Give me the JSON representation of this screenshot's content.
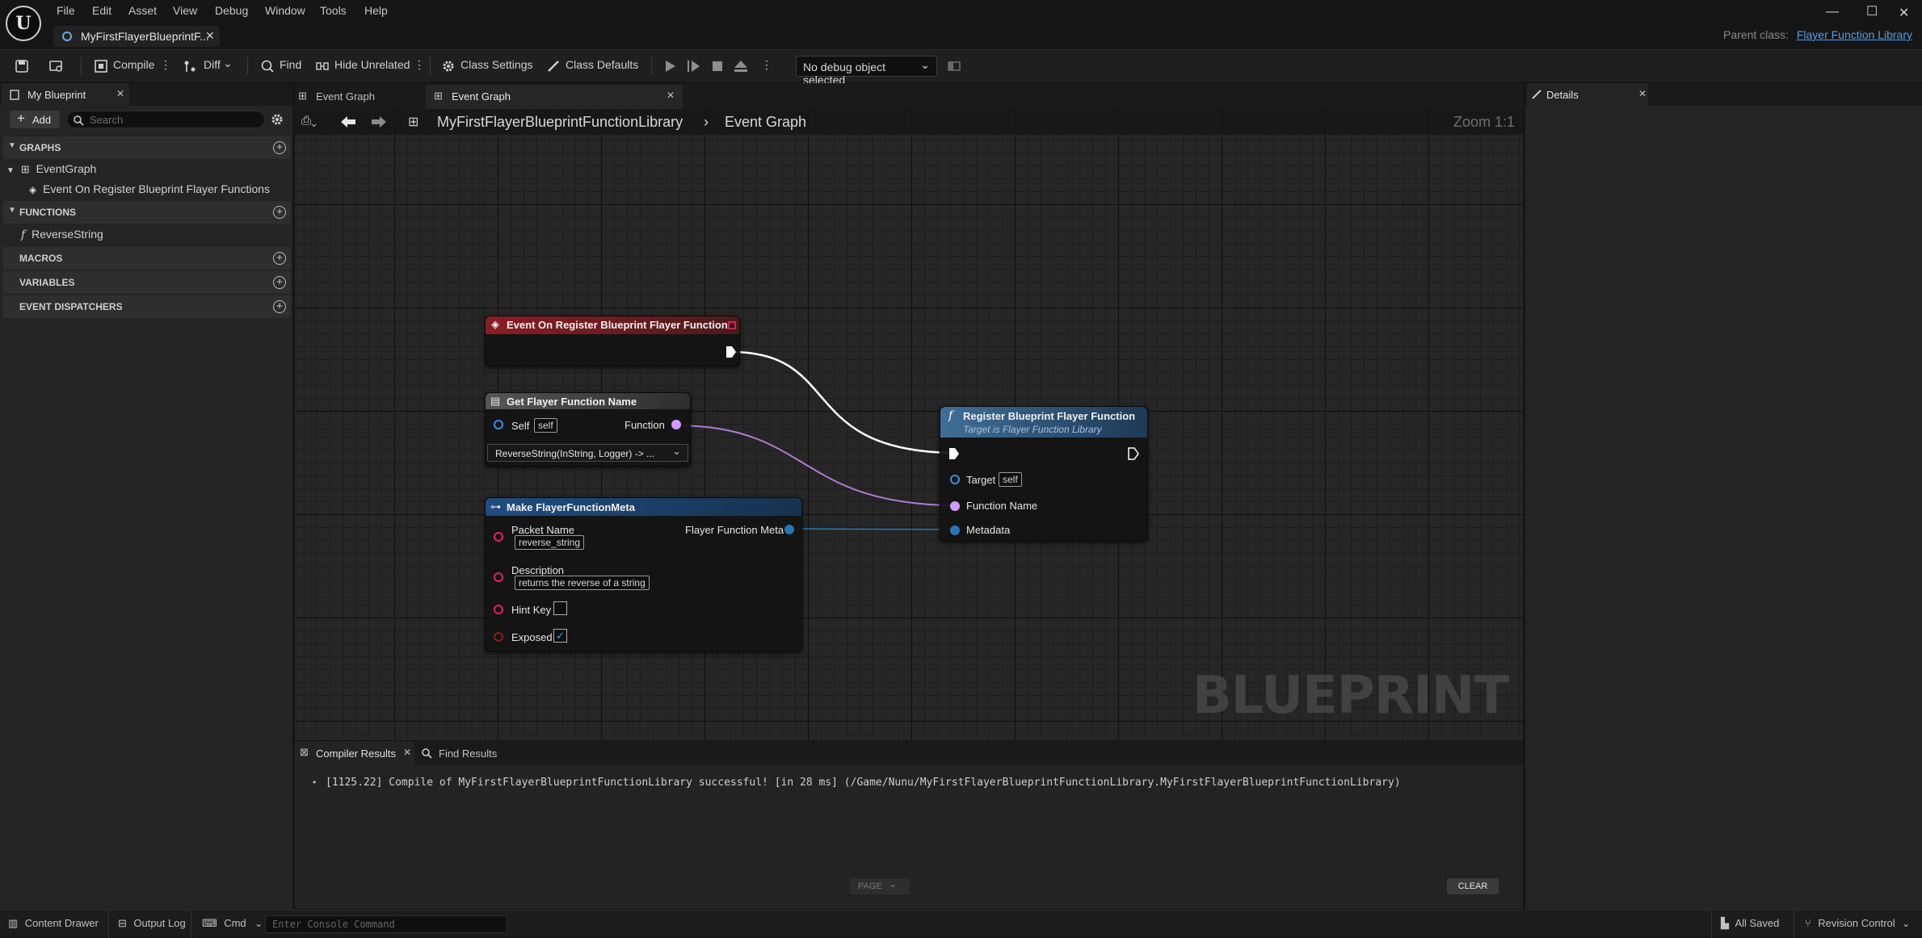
{
  "app": {
    "doc_tab": "MyFirstFlayerBlueprintF...",
    "parent_label": "Parent class:",
    "parent_value": "Flayer Function Library"
  },
  "menu": [
    "File",
    "Edit",
    "Asset",
    "View",
    "Debug",
    "Window",
    "Tools",
    "Help"
  ],
  "toolbar": {
    "compile": "Compile",
    "diff": "Diff",
    "find": "Find",
    "hide_unrelated": "Hide Unrelated",
    "class_settings": "Class Settings",
    "class_defaults": "Class Defaults",
    "debug_object": "No debug object selected"
  },
  "my_blueprint": {
    "tab": "My Blueprint",
    "add": "Add",
    "search_placeholder": "Search",
    "sections": {
      "graphs": "GRAPHS",
      "functions": "FUNCTIONS",
      "macros": "MACROS",
      "variables": "VARIABLES",
      "dispatchers": "EVENT DISPATCHERS"
    },
    "graph_items": [
      "EventGraph",
      "Event On Register Blueprint Flayer Functions"
    ],
    "function_items": [
      "ReverseString"
    ]
  },
  "graph": {
    "tabs": [
      "Event Graph",
      "Event Graph"
    ],
    "breadcrumb": [
      "MyFirstFlayerBlueprintFunctionLibrary",
      "Event Graph"
    ],
    "zoom": "Zoom 1:1",
    "watermark": "BLUEPRINT"
  },
  "nodes": {
    "event": {
      "title": "Event On Register Blueprint Flayer Functions"
    },
    "getname": {
      "title": "Get Flayer Function Name",
      "self_label": "Self",
      "self_value": "self",
      "function_label": "Function",
      "dropdown": "ReverseString(InString, Logger) -> ..."
    },
    "makemeta": {
      "title": "Make FlayerFunctionMeta",
      "packet_label": "Packet Name",
      "packet_value": "reverse_string",
      "description_label": "Description",
      "description_value": "returns the reverse of a string",
      "hint_label": "Hint Key",
      "exposed_label": "Exposed",
      "output_label": "Flayer Function Meta",
      "exposed_checked": true
    },
    "register": {
      "title": "Register Blueprint Flayer Function",
      "subtitle": "Target is Flayer Function Library",
      "target_label": "Target",
      "target_value": "self",
      "fname_label": "Function Name",
      "metadata_label": "Metadata"
    }
  },
  "details": {
    "tab": "Details"
  },
  "bottom": {
    "tabs": [
      "Compiler Results",
      "Find Results"
    ],
    "message": "[1125.22] Compile of MyFirstFlayerBlueprintFunctionLibrary successful! [in 28 ms] (/Game/Nunu/MyFirstFlayerBlueprintFunctionLibrary.MyFirstFlayerBlueprintFunctionLibrary)",
    "page": "PAGE",
    "clear": "CLEAR"
  },
  "status": {
    "content_drawer": "Content Drawer",
    "output_log": "Output Log",
    "cmd": "Cmd",
    "console_placeholder": "Enter Console Command",
    "saved": "All Saved",
    "revision": "Revision Control"
  },
  "colors": {
    "event_header": "#8a1d24",
    "func_header": "#2f4e6a",
    "struct_header": "#1e4d80",
    "exec_wire": "#ffffff",
    "string_wire": "#b07ad2",
    "struct_wire": "#2a74b8",
    "object_pin": "#3d8ee6",
    "string_pin": "#d39bff",
    "text_pin": "#e0226a"
  }
}
